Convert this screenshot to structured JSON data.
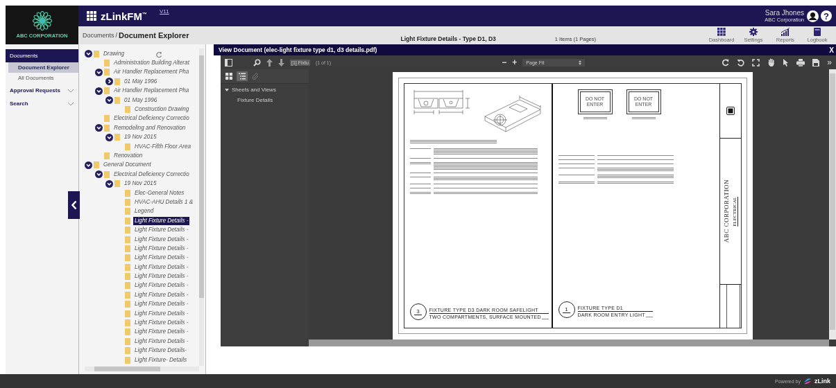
{
  "header": {
    "logo_text": "ABC CORPORATION",
    "app_name": "zLinkFM$^{™}$",
    "version": "V11",
    "user_name": "Sara Jhones",
    "user_org": "ABC Corporation",
    "help": "?"
  },
  "breadcrumb": {
    "parent": "Documents",
    "separator": "/",
    "current": "Document Explorer"
  },
  "document_title": "Light Fixture Details - Type D1, D3",
  "item_count": "1 Items (1 Pages)",
  "nav_links": [
    {
      "label": "Dashboard",
      "kind": "dashboard"
    },
    {
      "label": "Settings",
      "kind": "settings"
    },
    {
      "label": "Reports",
      "kind": "reports"
    },
    {
      "label": "Logbook",
      "kind": "logbook"
    }
  ],
  "sidebar": {
    "section": "Documents",
    "items": [
      {
        "label": "Document Explorer",
        "selected": true
      },
      {
        "label": "All Documents",
        "selected": false
      }
    ],
    "groups": [
      {
        "label": "Approval Requests",
        "expanded": false
      },
      {
        "label": "Search",
        "expanded": false
      }
    ]
  },
  "tree": [
    {
      "label": "Drawing",
      "selected": false,
      "expanded": true,
      "children": [
        {
          "label": "Administration Building Alterat",
          "selected": false
        },
        {
          "label": "Air Handler Replacement Pha",
          "selected": false,
          "expanded": true,
          "children": [
            {
              "label": "01 May 1996",
              "selected": false,
              "expanded": false
            }
          ]
        },
        {
          "label": "Air Handler Replacement Pha",
          "selected": false,
          "expanded": true,
          "children": [
            {
              "label": "01 May 1996",
              "selected": false,
              "expanded": true,
              "children": [
                {
                  "label": "Construction Drawing",
                  "selected": false
                }
              ]
            }
          ]
        },
        {
          "label": "Electrical Deficiency Correctio",
          "selected": false
        },
        {
          "label": "Remodeling and Renovation",
          "selected": false,
          "expanded": true,
          "children": [
            {
              "label": "19 Nov 2015",
              "selected": false,
              "expanded": true,
              "children": [
                {
                  "label": "HVAC-Fifth Floor Area",
                  "selected": false
                }
              ]
            }
          ]
        },
        {
          "label": "Renovation",
          "selected": false
        }
      ]
    },
    {
      "label": "General Document",
      "selected": false,
      "expanded": true,
      "children": [
        {
          "label": "Electrical Deficiency Correctio",
          "selected": false,
          "expanded": true,
          "children": [
            {
              "label": "19 Nov 2015",
              "selected": false,
              "expanded": true,
              "children": [
                {
                  "label": "Elec-General Notes",
                  "selected": false
                },
                {
                  "label": "HVAC-AHU Details 1 &",
                  "selected": false
                },
                {
                  "label": "Legend",
                  "selected": false
                },
                {
                  "label": "Light Fixture Details -",
                  "selected": true
                },
                {
                  "label": "Light Fixture Details -",
                  "selected": false
                },
                {
                  "label": "Light Fixture Details -",
                  "selected": false
                },
                {
                  "label": "Light Fixture Details -",
                  "selected": false
                },
                {
                  "label": "Light Fixture Details -",
                  "selected": false
                },
                {
                  "label": "Light Fixture Details -",
                  "selected": false
                },
                {
                  "label": "Light Fixture Details -",
                  "selected": false
                },
                {
                  "label": "Light Fixture Details -",
                  "selected": false
                },
                {
                  "label": "Light Fixture Details -",
                  "selected": false
                },
                {
                  "label": "Light Fixture Details -",
                  "selected": false
                },
                {
                  "label": "Light Fixture Details -",
                  "selected": false
                },
                {
                  "label": "Light Fixture Details -",
                  "selected": false
                },
                {
                  "label": "Light Fixture Details -",
                  "selected": false
                },
                {
                  "label": "Light Fixture Details -",
                  "selected": false
                },
                {
                  "label": "Light Fixture Details-",
                  "selected": false
                },
                {
                  "label": "Light Fixture- Details",
                  "selected": false
                }
              ]
            }
          ]
        }
      ]
    }
  ],
  "viewer": {
    "title": "View Document (elec-light fixture type d1, d3 details.pdf)",
    "close": "X",
    "page_field": "[1] Fixtu",
    "page_count": "(1 of 1)",
    "zoom_out": "−",
    "zoom_in": "+",
    "zoom_mode": "Page Fit",
    "more": "»",
    "panel_tabs": [
      {
        "kind": "thumbnails",
        "selected": false,
        "disabled": false
      },
      {
        "kind": "outline",
        "selected": true,
        "disabled": false
      },
      {
        "kind": "attachments",
        "selected": false,
        "disabled": true
      }
    ],
    "outline": [
      {
        "label": "Sheets and Views",
        "expanded": true,
        "children": [
          {
            "label": "Fixture Details"
          }
        ]
      }
    ],
    "sheet": {
      "left": {
        "tag_number": "3",
        "title": "FIXTURE TYPE D3 DARK ROOM SAFELIGHT",
        "subtitle": "TWO COMPARTMENTS, SURFACE MOUNTED"
      },
      "right": {
        "signs": [
          {
            "lines": [
              "DO NOT",
              "ENTER"
            ]
          },
          {
            "lines": [
              "DO NOT",
              "ENTER"
            ]
          }
        ],
        "tag_number": "1",
        "title": "FIXTURE TYPE D1",
        "subtitle": "DARK ROOM ENTRY LIGHT"
      },
      "company": "ABC CORPORATION",
      "discipline": "ELECTRICAL"
    }
  },
  "footer": {
    "powered_by": "Powered by",
    "brand": "zLink"
  }
}
